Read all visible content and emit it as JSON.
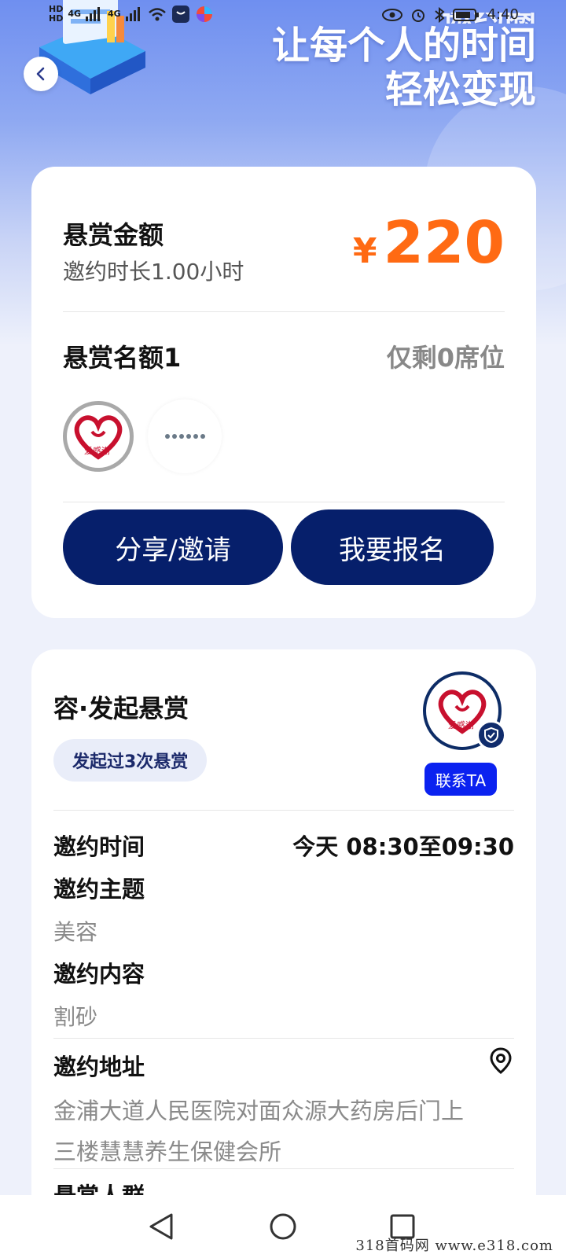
{
  "status_bar": {
    "network_tag_1": "HD",
    "network_tag_2": "HD",
    "signal_1": "4G",
    "signal_2": "4G",
    "time": "4:40"
  },
  "hero": {
    "slogan_top_cut": "邀约圈",
    "slogan_line1": "让每个人的时间",
    "slogan_line2": "轻松变现"
  },
  "reward_card": {
    "amount_label": "悬赏金额",
    "duration_text": "邀约时长1.00小时",
    "currency": "¥",
    "amount": "220",
    "quota_label": "悬赏名额1",
    "remaining_text": "仅剩0席位",
    "participant_logo_text": "爱感谢",
    "share_button": "分享/邀请",
    "signup_button": "我要报名"
  },
  "detail_card": {
    "publisher_title": "容·发起悬赏",
    "publish_count_badge": "发起过3次悬赏",
    "contact_button": "联系TA",
    "avatar_logo_text": "爱感谢",
    "time_label": "邀约时间",
    "time_value": "今天 08:30至09:30",
    "topic_label": "邀约主题",
    "topic_value": "美容",
    "content_label": "邀约内容",
    "content_value": "割砂",
    "address_label": "邀约地址",
    "address_line1": "金浦大道人民医院对面众源大药房后门上",
    "address_line2": "三楼慧慧养生保健会所",
    "crowd_label": "悬赏人群"
  },
  "watermark": "318首码网  www.e318.com",
  "colors": {
    "accent_orange": "#ff6a13",
    "navy": "#061f6b",
    "contact_blue": "#0b22f0"
  }
}
